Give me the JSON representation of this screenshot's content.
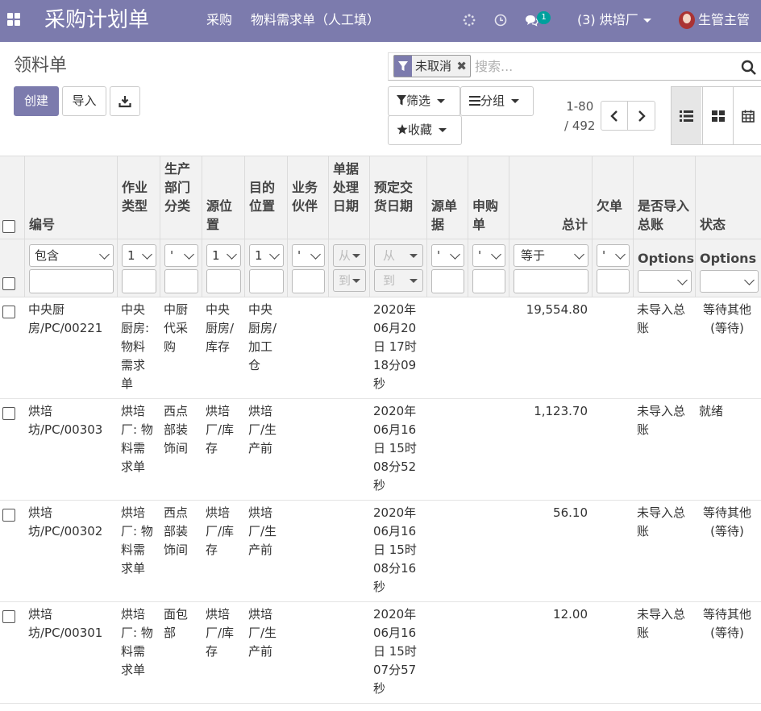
{
  "navbar": {
    "app_title": "采购计划单",
    "menu": [
      "采购",
      "物料需求单（人工填）"
    ],
    "message_count": "1",
    "company": "(3) 烘培厂",
    "user": "生管主管",
    "bg_color": "#7c7bad"
  },
  "control": {
    "breadcrumb": "领料单",
    "create_label": "创建",
    "import_label": "导入",
    "facet_label": "未取消",
    "search_placeholder": "搜索...",
    "filter_label": "筛选",
    "group_label": "分组",
    "favorite_label": "收藏",
    "pager_range": "1-80",
    "pager_total": "/ 492"
  },
  "table": {
    "headers": {
      "code": "编号",
      "op_type": [
        "作业",
        "类型"
      ],
      "dept": [
        "生产",
        "部门",
        "分类"
      ],
      "src_loc": [
        "源位",
        "置"
      ],
      "dest_loc": [
        "目的",
        "位置"
      ],
      "partner": [
        "业务",
        "伙伴"
      ],
      "process_date": [
        "单据",
        "处理",
        "日期"
      ],
      "delivery_date": [
        "预定交",
        "货日期"
      ],
      "src_doc": [
        "源单",
        "据"
      ],
      "purchase_req": [
        "申购",
        "单"
      ],
      "total": "总计",
      "backorder": "欠单",
      "ledger": [
        "是否导入",
        "总账"
      ],
      "state": "状态"
    },
    "filters": {
      "code_op": "包含",
      "optype_op": "1",
      "dept_op": "'",
      "src_op": "1",
      "dest_op": "1",
      "partner_op": "'",
      "from_label": "从",
      "to_label": "到",
      "srcdoc_op": "'",
      "preq_op": "'",
      "total_op": "等于",
      "backorder_op": "'",
      "options_label": "Options"
    },
    "rows": [
      {
        "code": [
          "中央厨",
          "房/PC/00221"
        ],
        "op_type": [
          "中央",
          "厨房:",
          "物料",
          "需求",
          "单"
        ],
        "dept": [
          "中厨",
          "代采",
          "购"
        ],
        "src_loc": [
          "中央",
          "厨房/",
          "库存"
        ],
        "dest_loc": [
          "中央",
          "厨房/",
          "加工",
          "仓"
        ],
        "delivery_date": [
          "2020年",
          "06月20",
          "日 17时",
          "18分09",
          "秒"
        ],
        "total": "19,554.80",
        "ledger": [
          "未导入总",
          "账"
        ],
        "state": [
          "等待其他",
          "(等待)"
        ]
      },
      {
        "code": [
          "烘培",
          "坊/PC/00303"
        ],
        "op_type": [
          "烘培",
          "厂: 物",
          "料需",
          "求单"
        ],
        "dept": [
          "西点",
          "部装",
          "饰间"
        ],
        "src_loc": [
          "烘培",
          "厂/库",
          "存"
        ],
        "dest_loc": [
          "烘培",
          "厂/生",
          "产前"
        ],
        "delivery_date": [
          "2020年",
          "06月16",
          "日 15时",
          "08分52",
          "秒"
        ],
        "total": "1,123.70",
        "ledger": [
          "未导入总",
          "账"
        ],
        "state": [
          "就绪"
        ]
      },
      {
        "code": [
          "烘培",
          "坊/PC/00302"
        ],
        "op_type": [
          "烘培",
          "厂: 物",
          "料需",
          "求单"
        ],
        "dept": [
          "西点",
          "部装",
          "饰间"
        ],
        "src_loc": [
          "烘培",
          "厂/库",
          "存"
        ],
        "dest_loc": [
          "烘培",
          "厂/生",
          "产前"
        ],
        "delivery_date": [
          "2020年",
          "06月16",
          "日 15时",
          "08分16",
          "秒"
        ],
        "total": "56.10",
        "ledger": [
          "未导入总",
          "账"
        ],
        "state": [
          "等待其他",
          "(等待)"
        ]
      },
      {
        "code": [
          "烘培",
          "坊/PC/00301"
        ],
        "op_type": [
          "烘培",
          "厂: 物",
          "料需",
          "求单"
        ],
        "dept": [
          "面包",
          "部"
        ],
        "src_loc": [
          "烘培",
          "厂/库",
          "存"
        ],
        "dest_loc": [
          "烘培",
          "厂/生",
          "产前"
        ],
        "delivery_date": [
          "2020年",
          "06月16",
          "日 15时",
          "07分57",
          "秒"
        ],
        "total": "12.00",
        "ledger": [
          "未导入总",
          "账"
        ],
        "state": [
          "等待其他",
          "(等待)"
        ]
      }
    ]
  }
}
